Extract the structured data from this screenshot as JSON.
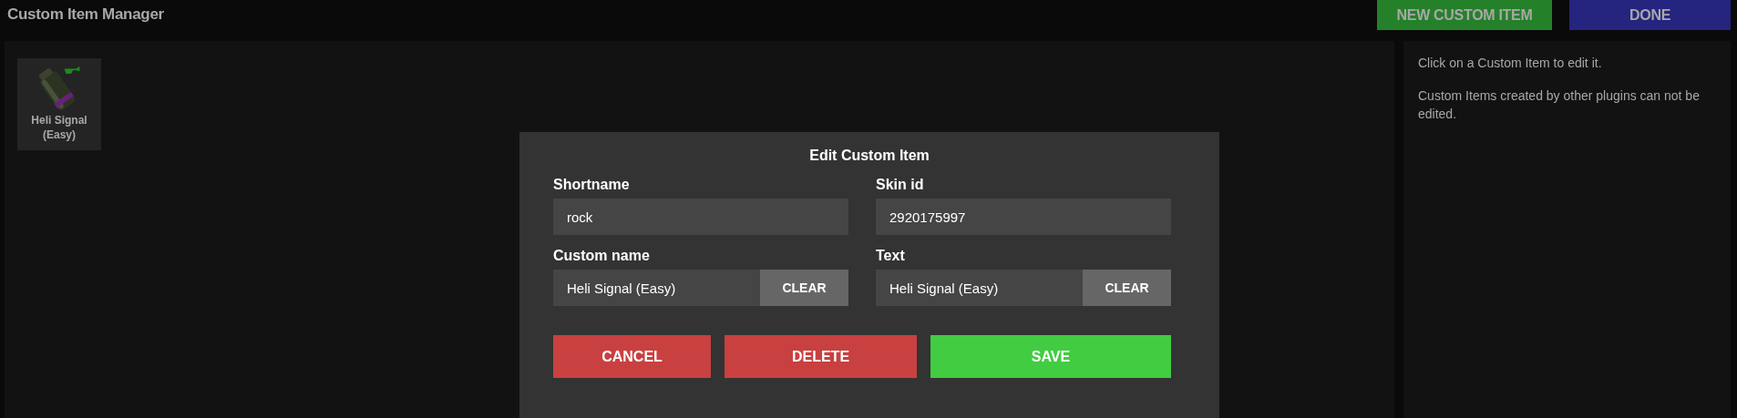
{
  "title": "Custom Item Manager",
  "header_buttons": [
    {
      "label": "NEW CUSTOM ITEM",
      "kind": "new"
    },
    {
      "label": "DONE",
      "kind": "done"
    }
  ],
  "items": [
    {
      "name": "Heli Signal (Easy)"
    }
  ],
  "info": [
    "Click on a Custom Item to edit it.",
    "Custom Items created by other plugins can not be edited."
  ],
  "dialog": {
    "title": "Edit Custom Item",
    "fields": [
      {
        "label": "Shortname",
        "value": "rock"
      },
      {
        "label": "Skin id",
        "value": "2920175997"
      },
      {
        "label": "Custom name",
        "value": "Heli Signal (Easy)",
        "clear_label": "CLEAR"
      },
      {
        "label": "Text",
        "value": "Heli Signal (Easy)",
        "clear_label": "CLEAR"
      }
    ],
    "buttons": [
      {
        "label": "CANCEL",
        "kind": "cancel"
      },
      {
        "label": "DELETE",
        "kind": "delete"
      },
      {
        "label": "SAVE",
        "kind": "save"
      }
    ]
  }
}
